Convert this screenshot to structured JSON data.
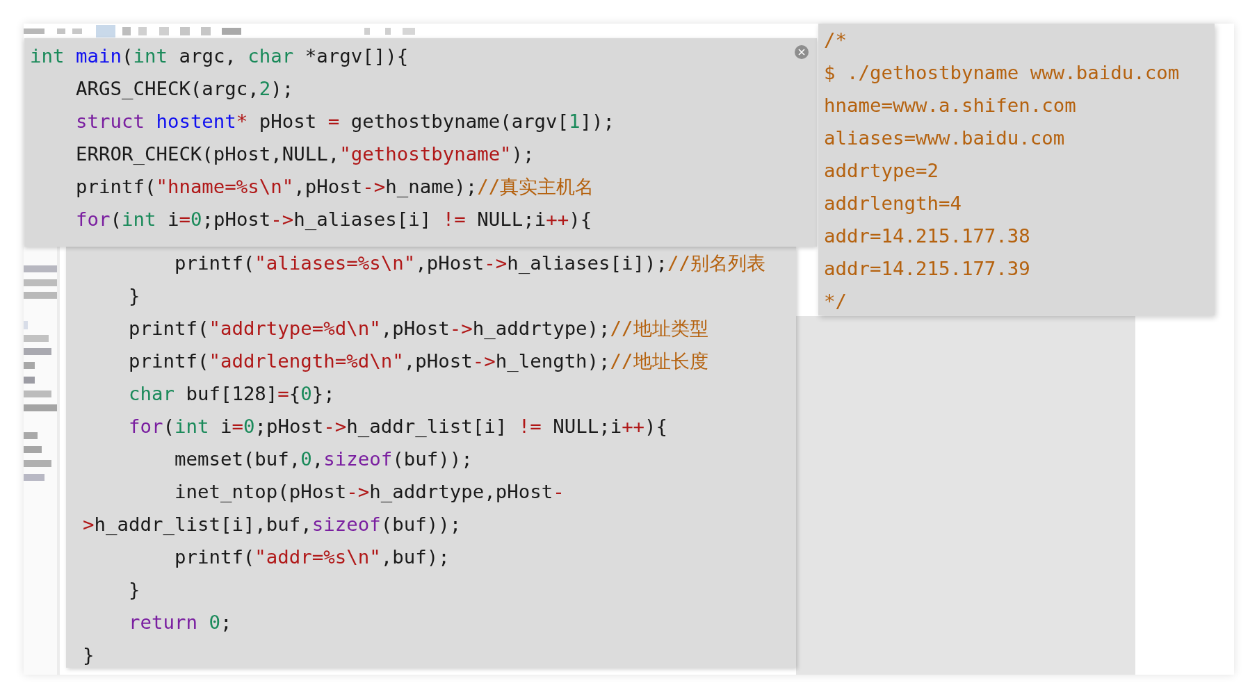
{
  "code_popup": {
    "lines": [
      [
        {
          "kind": "type",
          "text": "int "
        },
        {
          "kind": "func",
          "text": "main"
        },
        {
          "kind": "plain",
          "text": "("
        },
        {
          "kind": "type",
          "text": "int"
        },
        {
          "kind": "plain",
          "text": " argc, "
        },
        {
          "kind": "type",
          "text": "char"
        },
        {
          "kind": "plain",
          "text": " *argv[]){"
        }
      ],
      [
        {
          "kind": "plain",
          "text": "    ARGS_CHECK(argc,"
        },
        {
          "kind": "number",
          "text": "2"
        },
        {
          "kind": "plain",
          "text": ");"
        }
      ],
      [
        {
          "kind": "keyword",
          "text": "    struct "
        },
        {
          "kind": "func",
          "text": "hostent"
        },
        {
          "kind": "op",
          "text": "*"
        },
        {
          "kind": "plain",
          "text": " pHost "
        },
        {
          "kind": "op",
          "text": "="
        },
        {
          "kind": "plain",
          "text": " gethostbyname(argv["
        },
        {
          "kind": "number",
          "text": "1"
        },
        {
          "kind": "plain",
          "text": "]);"
        }
      ],
      [
        {
          "kind": "plain",
          "text": "    ERROR_CHECK(pHost,NULL,"
        },
        {
          "kind": "string",
          "text": "\"gethostbyname\""
        },
        {
          "kind": "plain",
          "text": ");"
        }
      ],
      [
        {
          "kind": "plain",
          "text": "    printf("
        },
        {
          "kind": "string",
          "text": "\"hname=%s\\n\""
        },
        {
          "kind": "plain",
          "text": ",pHost"
        },
        {
          "kind": "op",
          "text": "->"
        },
        {
          "kind": "plain",
          "text": "h_name);"
        },
        {
          "kind": "comment",
          "text": "//真实主机名"
        }
      ],
      [
        {
          "kind": "keyword",
          "text": "    for"
        },
        {
          "kind": "plain",
          "text": "("
        },
        {
          "kind": "type",
          "text": "int"
        },
        {
          "kind": "plain",
          "text": " i"
        },
        {
          "kind": "op",
          "text": "="
        },
        {
          "kind": "number",
          "text": "0"
        },
        {
          "kind": "plain",
          "text": ";pHost"
        },
        {
          "kind": "op",
          "text": "->"
        },
        {
          "kind": "plain",
          "text": "h_aliases[i] "
        },
        {
          "kind": "op",
          "text": "!="
        },
        {
          "kind": "plain",
          "text": " NULL;i"
        },
        {
          "kind": "op",
          "text": "++"
        },
        {
          "kind": "plain",
          "text": "){"
        }
      ]
    ]
  },
  "code_continuation": {
    "lines": [
      [
        {
          "kind": "plain",
          "text": "        printf("
        },
        {
          "kind": "string",
          "text": "\"aliases=%s\\n\""
        },
        {
          "kind": "plain",
          "text": ",pHost"
        },
        {
          "kind": "op",
          "text": "->"
        },
        {
          "kind": "plain",
          "text": "h_aliases[i]);"
        },
        {
          "kind": "comment",
          "text": "//别名列表"
        }
      ],
      [
        {
          "kind": "plain",
          "text": "    }"
        }
      ],
      [
        {
          "kind": "plain",
          "text": "    printf("
        },
        {
          "kind": "string",
          "text": "\"addrtype=%d\\n\""
        },
        {
          "kind": "plain",
          "text": ",pHost"
        },
        {
          "kind": "op",
          "text": "->"
        },
        {
          "kind": "plain",
          "text": "h_addrtype);"
        },
        {
          "kind": "comment",
          "text": "//地址类型"
        }
      ],
      [
        {
          "kind": "plain",
          "text": "    printf("
        },
        {
          "kind": "string",
          "text": "\"addrlength=%d\\n\""
        },
        {
          "kind": "plain",
          "text": ",pHost"
        },
        {
          "kind": "op",
          "text": "->"
        },
        {
          "kind": "plain",
          "text": "h_length);"
        },
        {
          "kind": "comment",
          "text": "//地址长度"
        }
      ],
      [
        {
          "kind": "type",
          "text": "    char"
        },
        {
          "kind": "plain",
          "text": " buf[128]"
        },
        {
          "kind": "op",
          "text": "="
        },
        {
          "kind": "plain",
          "text": "{"
        },
        {
          "kind": "number",
          "text": "0"
        },
        {
          "kind": "plain",
          "text": "};"
        }
      ],
      [
        {
          "kind": "keyword",
          "text": "    for"
        },
        {
          "kind": "plain",
          "text": "("
        },
        {
          "kind": "type",
          "text": "int"
        },
        {
          "kind": "plain",
          "text": " i"
        },
        {
          "kind": "op",
          "text": "="
        },
        {
          "kind": "number",
          "text": "0"
        },
        {
          "kind": "plain",
          "text": ";pHost"
        },
        {
          "kind": "op",
          "text": "->"
        },
        {
          "kind": "plain",
          "text": "h_addr_list[i] "
        },
        {
          "kind": "op",
          "text": "!="
        },
        {
          "kind": "plain",
          "text": " NULL;i"
        },
        {
          "kind": "op",
          "text": "++"
        },
        {
          "kind": "plain",
          "text": "){"
        }
      ],
      [
        {
          "kind": "plain",
          "text": "        memset(buf,"
        },
        {
          "kind": "number",
          "text": "0"
        },
        {
          "kind": "plain",
          "text": ","
        },
        {
          "kind": "keyword",
          "text": "sizeof"
        },
        {
          "kind": "plain",
          "text": "(buf));"
        }
      ],
      [
        {
          "kind": "plain",
          "text": "        inet_ntop(pHost"
        },
        {
          "kind": "op",
          "text": "->"
        },
        {
          "kind": "plain",
          "text": "h_addrtype,pHost"
        },
        {
          "kind": "op",
          "text": "-"
        }
      ],
      [
        {
          "kind": "op",
          "text": ">"
        },
        {
          "kind": "plain",
          "text": "h_addr_list[i],buf,"
        },
        {
          "kind": "keyword",
          "text": "sizeof"
        },
        {
          "kind": "plain",
          "text": "(buf));"
        }
      ],
      [
        {
          "kind": "plain",
          "text": "        printf("
        },
        {
          "kind": "string",
          "text": "\"addr=%s\\n\""
        },
        {
          "kind": "plain",
          "text": ",buf);"
        }
      ],
      [
        {
          "kind": "plain",
          "text": "    }"
        }
      ],
      [
        {
          "kind": "keyword",
          "text": "    return "
        },
        {
          "kind": "number",
          "text": "0"
        },
        {
          "kind": "plain",
          "text": ";"
        }
      ],
      [
        {
          "kind": "plain",
          "text": "}"
        }
      ]
    ]
  },
  "output_comment": {
    "lines": [
      "/*",
      "$ ./gethostbyname www.baidu.com",
      "hname=www.a.shifen.com",
      "aliases=www.baidu.com",
      "addrtype=2",
      "addrlength=4",
      "addr=14.215.177.38",
      "addr=14.215.177.39",
      "*/"
    ]
  }
}
